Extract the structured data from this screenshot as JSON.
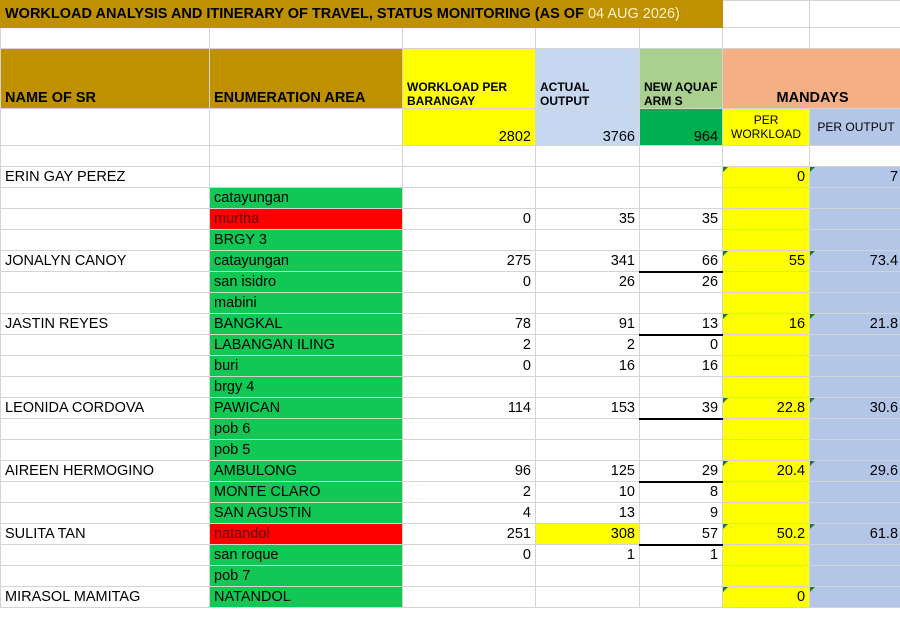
{
  "title": {
    "main": "WORKLOAD ANALYSIS AND ITINERARY OF TRAVEL, STATUS MONITORING (AS OF",
    "date": " 04 AUG 2026)"
  },
  "headers": {
    "name_of_sr": "NAME OF SR",
    "enumeration_area": "ENUMERATION AREA",
    "workload_per_barangay": "WORKLOAD PER BARANGAY",
    "actual_output": "ACTUAL OUTPUT",
    "new_aquafarms": "NEW AQUAFARM S",
    "mandays": "MANDAYS",
    "per_workload": "PER WORKLOAD",
    "per_output": "PER OUTPUT"
  },
  "totals": {
    "workload": "2802",
    "actual": "3766",
    "new": "964"
  },
  "rows": [
    {
      "name": "ERIN GAY PEREZ",
      "area": "",
      "workload": "",
      "actual": "",
      "new": "",
      "per_workload": "0",
      "per_output": "7"
    },
    {
      "name": "",
      "area": "catayungan",
      "workload": "",
      "actual": "",
      "new": "",
      "per_workload": "",
      "per_output": ""
    },
    {
      "name": "",
      "area": "murtha",
      "workload": "0",
      "actual": "35",
      "new": "35",
      "per_workload": "",
      "per_output": ""
    },
    {
      "name": "",
      "area": "BRGY 3",
      "workload": "",
      "actual": "",
      "new": "",
      "per_workload": "",
      "per_output": ""
    },
    {
      "name": "JONALYN CANOY",
      "area": "catayungan",
      "workload": "275",
      "actual": "341",
      "new": "66",
      "per_workload": "55",
      "per_output": "73.4"
    },
    {
      "name": "",
      "area": "san isidro",
      "workload": "0",
      "actual": "26",
      "new": "26",
      "per_workload": "",
      "per_output": ""
    },
    {
      "name": "",
      "area": "mabini",
      "workload": "",
      "actual": "",
      "new": "",
      "per_workload": "",
      "per_output": ""
    },
    {
      "name": "JASTIN REYES",
      "area": "BANGKAL",
      "workload": "78",
      "actual": "91",
      "new": "13",
      "per_workload": "16",
      "per_output": "21.8"
    },
    {
      "name": "",
      "area": "LABANGAN ILING",
      "workload": "2",
      "actual": "2",
      "new": "0",
      "per_workload": "",
      "per_output": ""
    },
    {
      "name": "",
      "area": "buri",
      "workload": "0",
      "actual": "16",
      "new": "16",
      "per_workload": "",
      "per_output": ""
    },
    {
      "name": "",
      "area": "brgy 4",
      "workload": "",
      "actual": "",
      "new": "",
      "per_workload": "",
      "per_output": ""
    },
    {
      "name": "LEONIDA CORDOVA",
      "area": "PAWICAN",
      "workload": "114",
      "actual": "153",
      "new": "39",
      "per_workload": "22.8",
      "per_output": "30.6"
    },
    {
      "name": "",
      "area": "pob 6",
      "workload": "",
      "actual": "",
      "new": "",
      "per_workload": "",
      "per_output": ""
    },
    {
      "name": "",
      "area": "pob 5",
      "workload": "",
      "actual": "",
      "new": "",
      "per_workload": "",
      "per_output": ""
    },
    {
      "name": "AIREEN HERMOGINO",
      "area": "AMBULONG",
      "workload": "96",
      "actual": "125",
      "new": "29",
      "per_workload": "20.4",
      "per_output": "29.6"
    },
    {
      "name": "",
      "area": "MONTE CLARO",
      "workload": "2",
      "actual": "10",
      "new": "8",
      "per_workload": "",
      "per_output": ""
    },
    {
      "name": "",
      "area": "SAN AGUSTIN",
      "workload": "4",
      "actual": "13",
      "new": "9",
      "per_workload": "",
      "per_output": ""
    },
    {
      "name": "SULITA TAN",
      "area": "natandol",
      "workload": "251",
      "actual": "308",
      "new": "57",
      "per_workload": "50.2",
      "per_output": "61.8"
    },
    {
      "name": "",
      "area": "san roque",
      "workload": "0",
      "actual": "1",
      "new": "1",
      "per_workload": "",
      "per_output": ""
    },
    {
      "name": "",
      "area": "pob 7",
      "workload": "",
      "actual": "",
      "new": "",
      "per_workload": "",
      "per_output": ""
    },
    {
      "name": "MIRASOL MAMITAG",
      "area": "NATANDOL",
      "workload": "",
      "actual": "",
      "new": "",
      "per_workload": "0",
      "per_output": ""
    }
  ]
}
